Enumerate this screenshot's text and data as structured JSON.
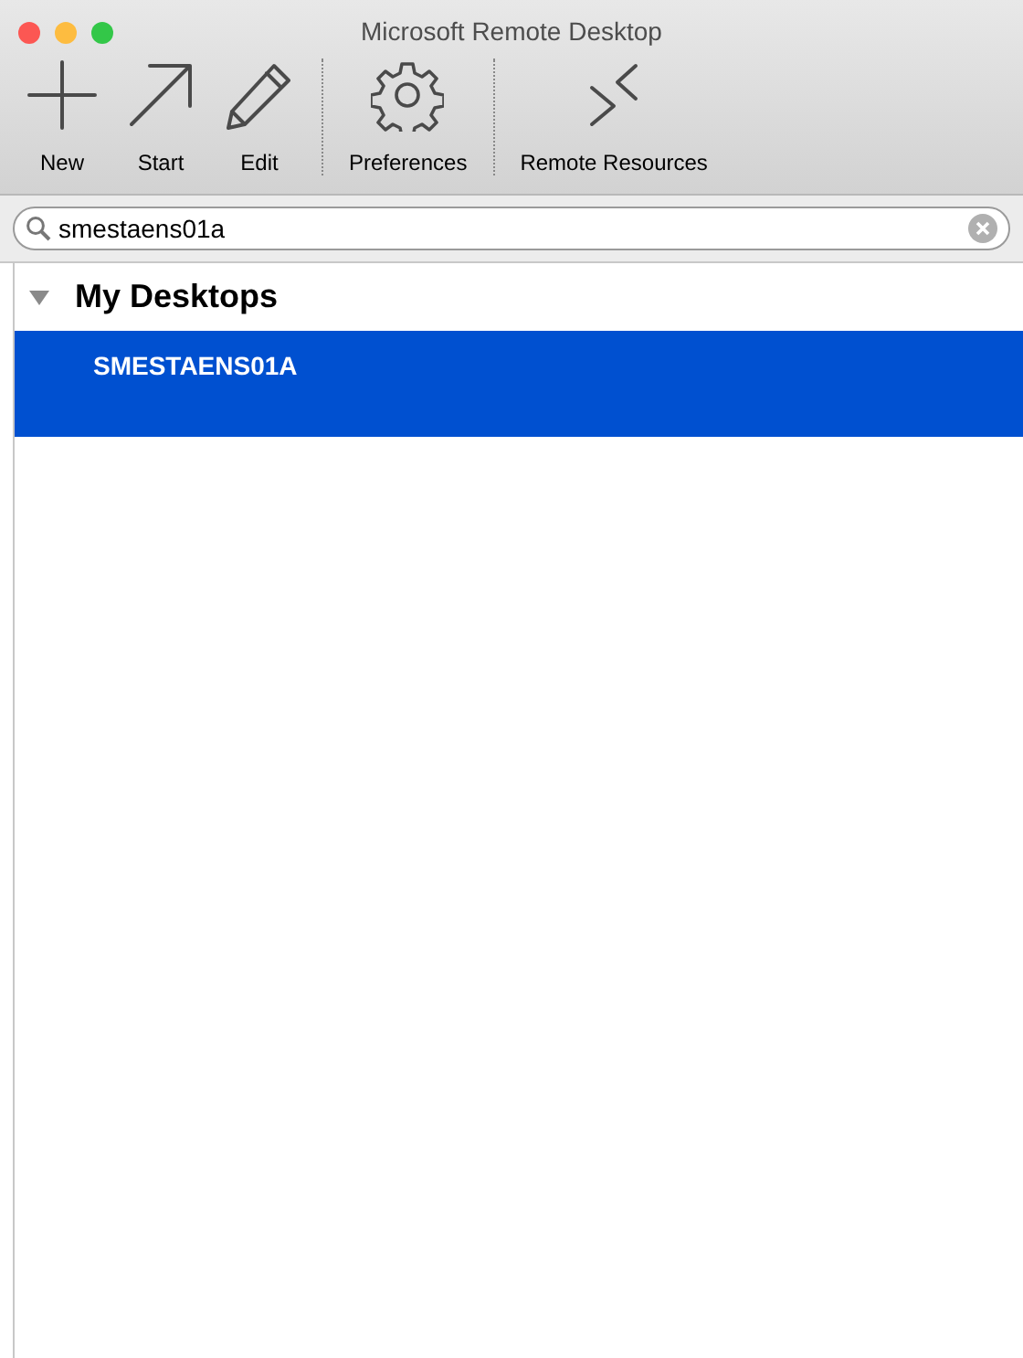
{
  "window": {
    "title": "Microsoft Remote Desktop"
  },
  "toolbar": {
    "groups": [
      {
        "items": [
          {
            "label": "New"
          },
          {
            "label": "Start"
          },
          {
            "label": "Edit"
          }
        ]
      },
      {
        "items": [
          {
            "label": "Preferences"
          }
        ]
      },
      {
        "items": [
          {
            "label": "Remote Resources"
          }
        ]
      }
    ]
  },
  "search": {
    "value": "smestaens01a"
  },
  "tree": [
    {
      "label": "My Desktops",
      "expanded": true,
      "children": [
        {
          "label": "SMESTAENS01A",
          "selected": true
        }
      ]
    }
  ]
}
